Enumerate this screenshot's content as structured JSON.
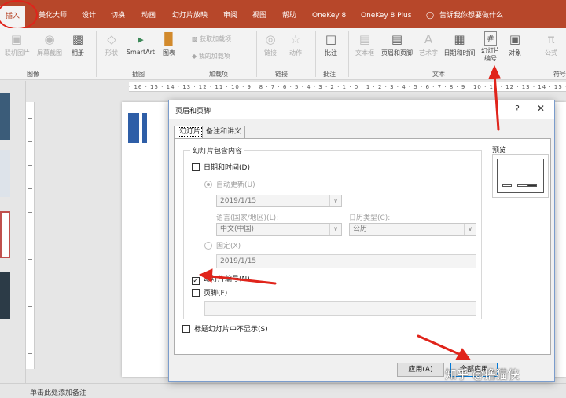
{
  "ribbon_tabs": [
    {
      "label": "插入",
      "active": true
    },
    {
      "label": "美化大师"
    },
    {
      "label": "设计"
    },
    {
      "label": "切换"
    },
    {
      "label": "动画"
    },
    {
      "label": "幻灯片放映"
    },
    {
      "label": "审阅"
    },
    {
      "label": "视图"
    },
    {
      "label": "帮助"
    },
    {
      "label": "OneKey 8"
    },
    {
      "label": "OneKey 8 Plus"
    }
  ],
  "tell_me": {
    "icon": "lightbulb-icon",
    "text": "告诉我你想要做什么"
  },
  "ribbon": {
    "images": {
      "online_pictures": "联机图片",
      "screenshot": "屏幕截图",
      "album": "相册",
      "group": "图像"
    },
    "illustrations": {
      "shapes": "形状",
      "smartart": "SmartArt",
      "chart": "图表",
      "group": "插图"
    },
    "addins": {
      "get": "获取加载项",
      "mine": "我的加载项",
      "group": "加载项"
    },
    "links": {
      "link": "链接",
      "action": "动作",
      "group": "链接"
    },
    "comments": {
      "comment": "批注",
      "group": "批注"
    },
    "text": {
      "textbox": "文本框",
      "header_footer": "页眉和页脚",
      "wordart": "艺术字",
      "date_time": "日期和时间",
      "slide_number": "幻灯片\n编号",
      "object": "对象",
      "group": "文本"
    },
    "symbols": {
      "equation": "公式",
      "group": "符号"
    }
  },
  "ruler_text": "· 16 · 15 · 14 · 13 · 12 · 11 · 10 · 9 · 8 · 7 · 6 · 5 · 4 · 3 · 2 · 1 · 0 · 1 · 2 · 3 · 4 · 5 · 6 · 7 · 8 · 9 · 10 · 11 · 12 · 13 · 14 · 15 · 16 ·",
  "status": {
    "notes_placeholder": "单击此处添加备注"
  },
  "dialog": {
    "title": "页眉和页脚",
    "help": "?",
    "close": "✕",
    "tabs": [
      "幻灯片",
      "备注和讲义"
    ],
    "include_label": "幻灯片包含内容",
    "date_time": {
      "label": "日期和时间(D)",
      "checked": false
    },
    "auto_update": {
      "label": "自动更新(U)",
      "selected": true,
      "value": "2019/1/15"
    },
    "language_label": "语言(国家/地区)(L):",
    "language_value": "中文(中国)",
    "calendar_label": "日历类型(C):",
    "calendar_value": "公历",
    "fixed": {
      "label": "固定(X)",
      "selected": false,
      "value": "2019/1/15"
    },
    "slide_number": {
      "label": "幻灯片编号(N)",
      "checked": true
    },
    "footer": {
      "label": "页脚(F)",
      "checked": false,
      "value": ""
    },
    "no_title_slide": {
      "label": "标题幻灯片中不显示(S)",
      "checked": false
    },
    "preview_label": "预览",
    "apply": "应用(A)",
    "apply_all": "全部应用"
  },
  "watermark": "知乎 @撸猫侠",
  "colors": {
    "accent": "#b7472a",
    "annotation": "#e0241b",
    "slide_bar": "#2e5ea7"
  }
}
